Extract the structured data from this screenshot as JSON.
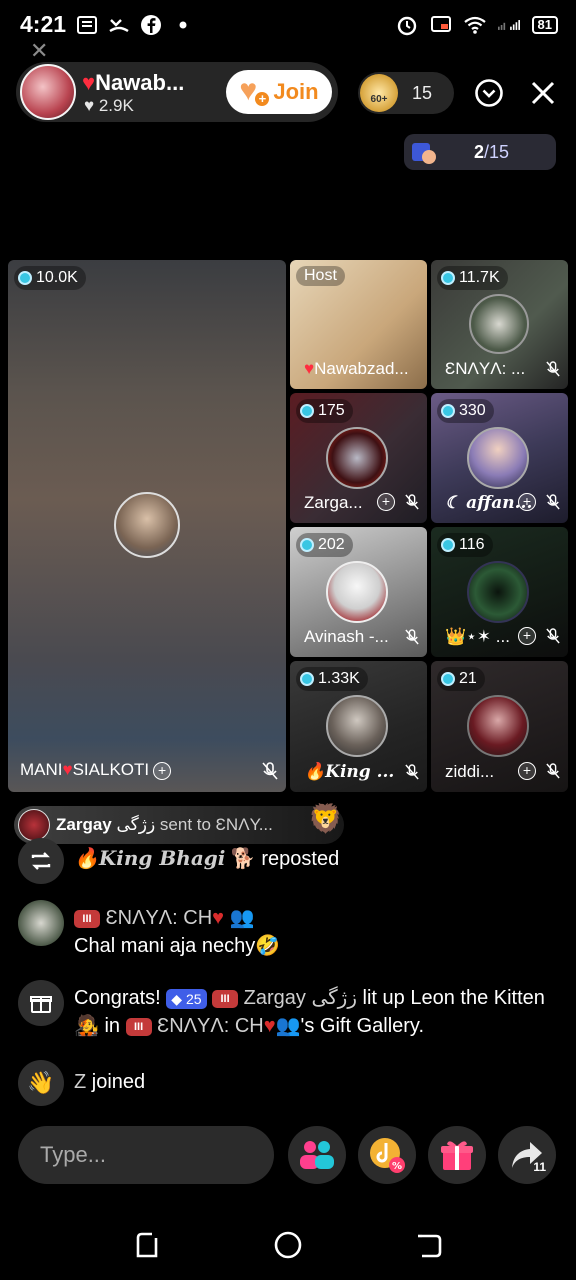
{
  "status_bar": {
    "time": "4:21",
    "battery": "81",
    "watermark": "✕"
  },
  "header": {
    "host_name": "Nawab...",
    "host_likes": "2.9K",
    "join_label": "Join",
    "viewer_badge": "60+",
    "viewer_count": "15",
    "guest_current": "2",
    "guest_total": "/15"
  },
  "tiles": {
    "main": {
      "coins": "10.0K",
      "name": "MANI",
      "name_suffix": "SIALKOTI"
    },
    "host": {
      "tag": "Host",
      "name": "Nawabzad..."
    },
    "enaya": {
      "coins": "11.7K",
      "name": "ƐNΛYΛ: ..."
    },
    "zarg": {
      "coins": "175",
      "name": "Zarga..."
    },
    "affan": {
      "coins": "330",
      "name": "☾ affan..."
    },
    "avinash": {
      "coins": "202",
      "name": "Avinash -..."
    },
    "king": {
      "coins": "116",
      "name": "👑⋆✶ ..."
    },
    "king2": {
      "coins": "1.33K",
      "name": "🔥King ..."
    },
    "ziddi": {
      "coins": "21",
      "name": "ziddi..."
    }
  },
  "gift_banner": {
    "sender": "Zargay",
    "sender_urdu": "زژگی",
    "text": "sent to ƐNΛY..."
  },
  "chat": [
    {
      "user": "🔥King Bhagi",
      "action": "reposted"
    },
    {
      "user": "ƐNΛYΛ: CH",
      "badge": "III",
      "message": "Chal mani aja nechy🤣"
    },
    {
      "prefix": "Congrats!",
      "gems": "25",
      "badge": "III",
      "sender": "Zargay زژگی",
      "middle": "lit up Leon the Kitten 🧑‍🎤 in",
      "target": "ƐNΛYΛ: CH",
      "suffix": "'s Gift Gallery."
    },
    {
      "user": "Z",
      "action": "joined"
    }
  ],
  "bottom_bar": {
    "placeholder": "Type...",
    "share_count": "11"
  }
}
